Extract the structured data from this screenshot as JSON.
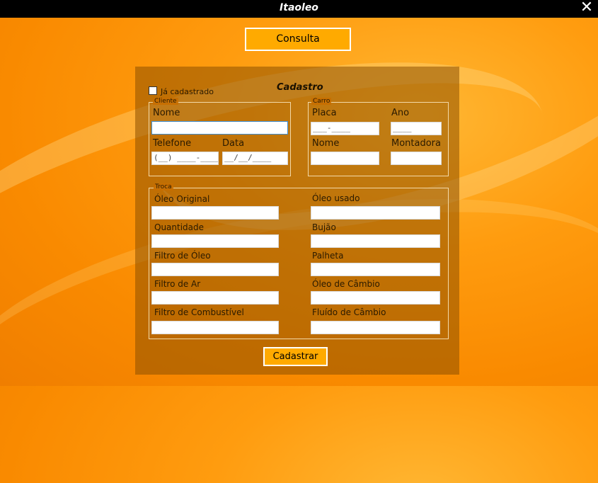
{
  "window": {
    "title": "Itaoleo"
  },
  "top": {
    "consulta_label": "Consulta"
  },
  "form": {
    "heading": "Cadastro",
    "ja_cadastrado": "Já cadastrado",
    "cliente": {
      "legend": "Cliente",
      "nome_label": "Nome",
      "nome_value": "",
      "telefone_label": "Telefone",
      "telefone_value": "(__) ____-____",
      "data_label": "Data",
      "data_value": "__/__/____"
    },
    "carro": {
      "legend": "Carro",
      "placa_label": "Placa",
      "placa_value": "___-____",
      "ano_label": "Ano",
      "ano_value": "____",
      "nome_label": "Nome",
      "nome_value": "",
      "montadora_label": "Montadora",
      "montadora_value": ""
    },
    "troca": {
      "legend": "Troca",
      "left": [
        "Óleo Original",
        "Quantidade",
        "Filtro de Óleo",
        "Filtro de Ar",
        "Filtro de Combustível"
      ],
      "right": [
        "Óleo usado",
        "Bujão",
        "Palheta",
        "Óleo de Câmbio",
        "Fluído de Câmbio"
      ]
    },
    "cadastrar_label": "Cadastrar"
  }
}
